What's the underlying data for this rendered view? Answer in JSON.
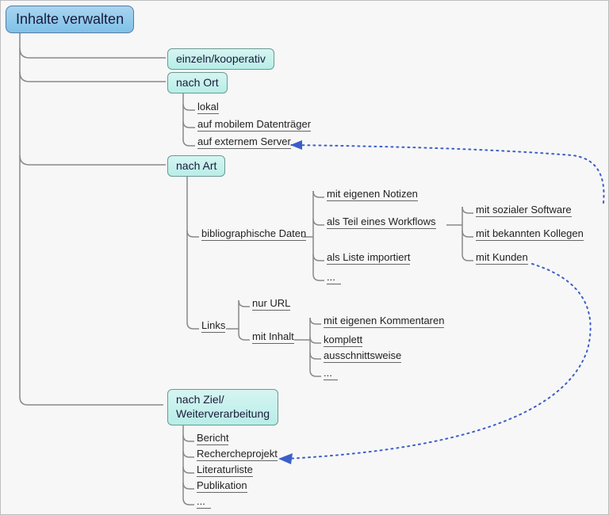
{
  "root": {
    "title": "Inhalte verwalten"
  },
  "level1": {
    "einzeln": "einzeln/kooperativ",
    "ort": "nach Ort",
    "art": "nach Art",
    "ziel_line1": "nach Ziel/",
    "ziel_line2": "Weiterverarbeitung"
  },
  "ort_children": {
    "lokal": "lokal",
    "mobil": "auf mobilem Datenträger",
    "extern": "auf externem Server"
  },
  "art_children": {
    "bib": "bibliographische Daten",
    "links": "Links"
  },
  "bib_children": {
    "notizen": "mit eigenen Notizen",
    "workflow": "als Teil eines Workflows",
    "liste": "als Liste importiert",
    "more": "..."
  },
  "workflow_children": {
    "sozial": "mit sozialer Software",
    "kollegen": "mit bekannten Kollegen",
    "kunden": "mit Kunden"
  },
  "links_children": {
    "url": "nur URL",
    "inhalt": "mit Inhalt"
  },
  "inhalt_children": {
    "komm": "mit eigenen Kommentaren",
    "komplett": "komplett",
    "ausschnitt": "ausschnittsweise",
    "more": "..."
  },
  "ziel_children": {
    "bericht": "Bericht",
    "recherche": "Rechercheprojekt",
    "lit": "Literaturliste",
    "pub": "Publikation",
    "more": "..."
  },
  "colors": {
    "connector": "#888888",
    "dashed": "#3b5fc9"
  }
}
